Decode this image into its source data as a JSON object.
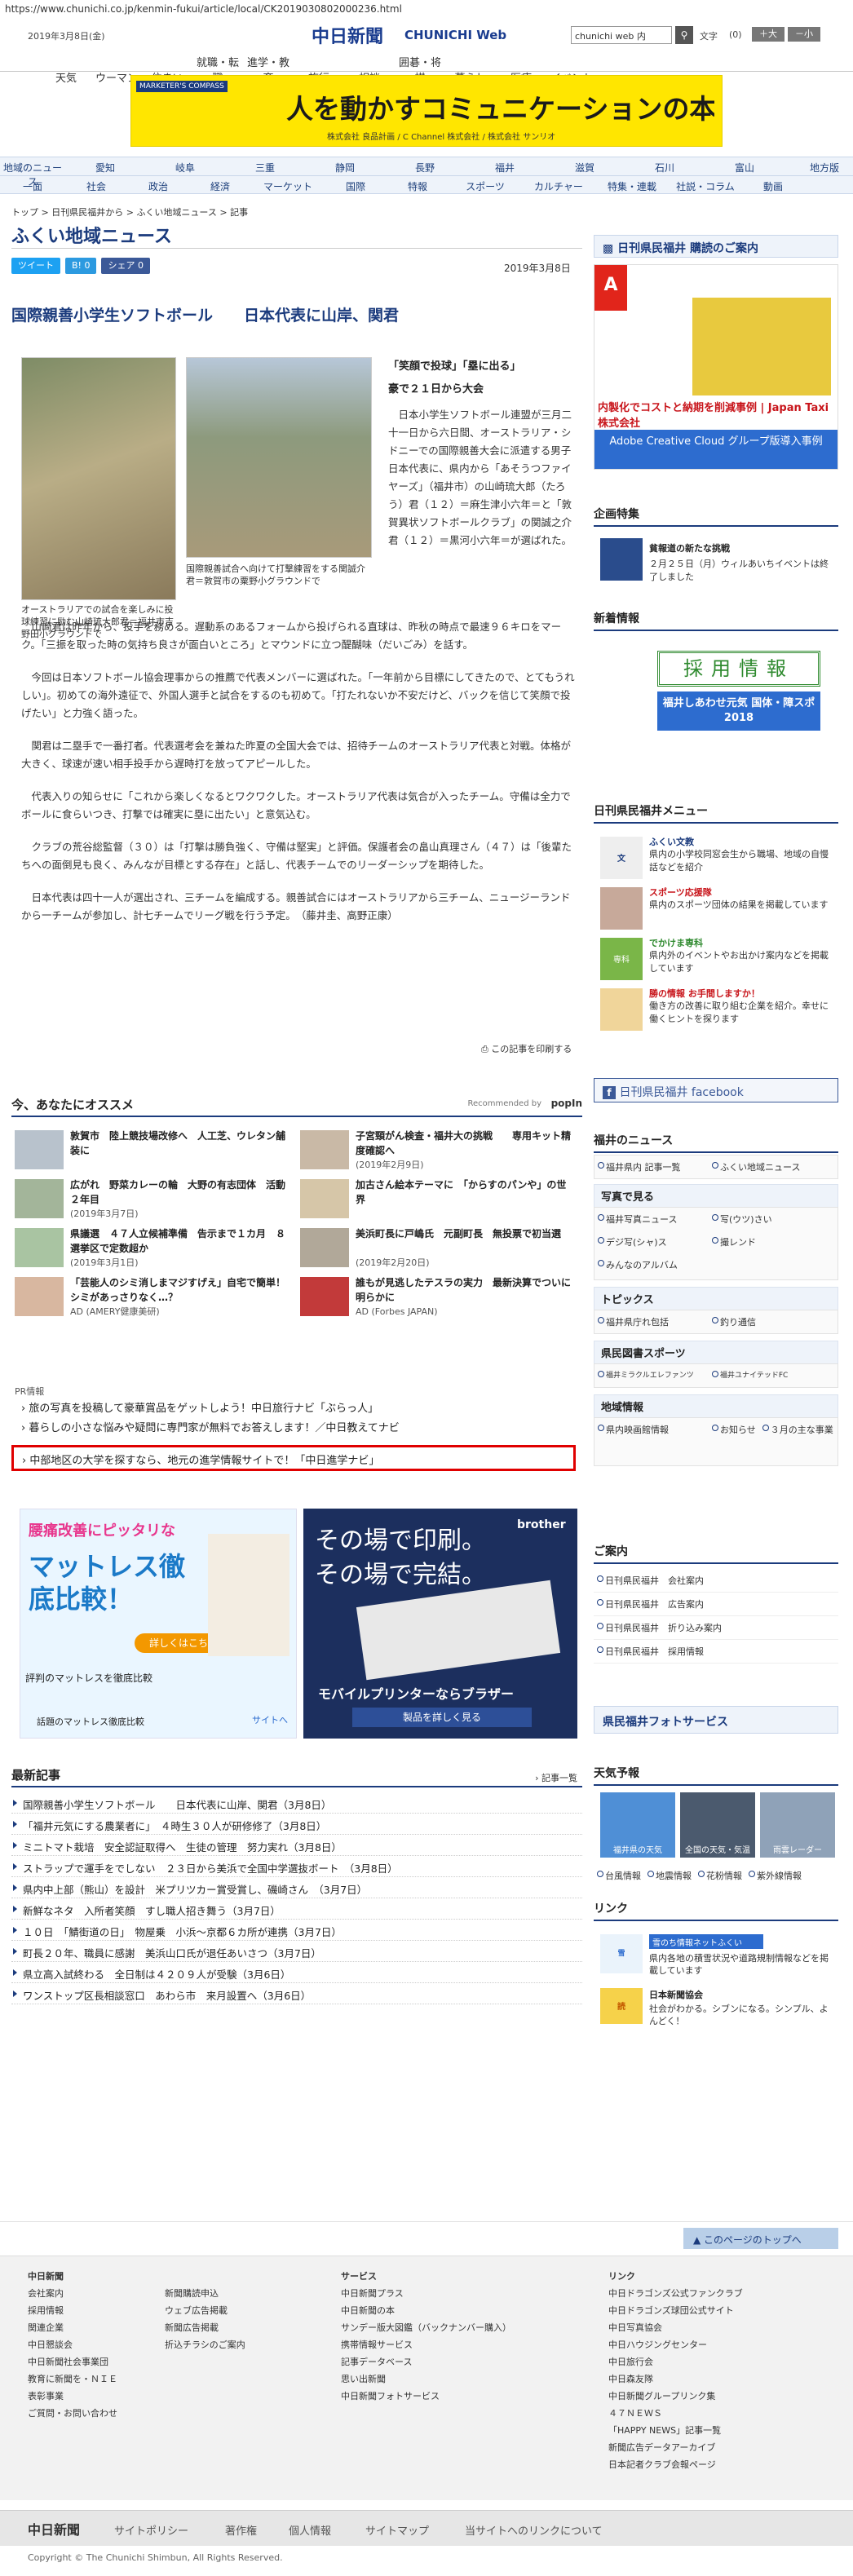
{
  "url": "https://www.chunichi.co.jp/kenmin-fukui/article/local/CK2019030802000236.html",
  "header": {
    "date": "2019年3月8日(金)",
    "logo": "中日新聞",
    "logo_en": "CHUNICHI Web",
    "search_value": "chunichi web 内",
    "char_label": "文字",
    "char_count": "(0)",
    "large": "＋大",
    "small": "－小"
  },
  "gnav": [
    "天気",
    "ウーマン",
    "住まい",
    "就職・転職",
    "進学・教育",
    "旅行",
    "相談",
    "囲碁・将棋",
    "暮らし",
    "医療",
    "イベント"
  ],
  "ad_top": {
    "headline": "人を動かすコミュニケーションの本質",
    "sub": "MARKETER'S COMPASS",
    "sponsor": "株式会社 良品計画 / C Channel 株式会社 / 株式会社 サンリオ"
  },
  "regional_nav": {
    "row1": [
      "地域のニュース",
      "愛知",
      "岐阜",
      "三重",
      "静岡",
      "長野",
      "福井",
      "滋賀",
      "石川",
      "富山",
      "地方版"
    ],
    "row2": [
      "一面",
      "社会",
      "政治",
      "経済",
      "マーケット",
      "国際",
      "特報",
      "スポーツ",
      "カルチャー",
      "特集・連載",
      "社説・コラム",
      "動画"
    ]
  },
  "breadcrumb": "トップ > 日刊県民福井から > ふくい地域ニュース > 記事",
  "section_title": "ふくい地域ニュース",
  "share": {
    "tweet": "ツイート",
    "hatena": "B! 0",
    "fb": "シェア 0"
  },
  "article": {
    "date": "2019年3月8日",
    "headline": "国際親善小学生ソフトボール　　日本代表に山岸、関君",
    "caption1": "オーストラリアでの試合を楽しみに投球練習に励む山崎琉大郎君＝福井市吉野田小グラウンドで",
    "caption2": "国際親善試合へ向けて打撃練習をする関誠介君＝敦賀市の粟野小グラウンドで",
    "sub1": "「笑顔で投球」「塁に出る」",
    "sub2": "豪で２１日から大会",
    "p_intro": "日本小学生ソフトボール連盟が三月二十一日から六日間、オーストラリア・シドニーでの国際親善大会に派遣する男子日本代表に、県内から「あそうつファイヤーズ」（福井市）の山崎琉大郎（たろう）君（１２）＝麻生津小六年＝と「敦賀異状ソフトボールクラブ」の関誠之介君（１２）＝黒河小六年＝が選ばれた。",
    "p1": "山崎君は昨年から、投手を務める。遅動系のあるフォームから投げられる直球は、昨秋の時点で最速９６キロをマーク。「三振を取った時の気持ち良さが面白いところ」とマウンドに立つ醍醐味（だいごみ）を話す。",
    "p2": "今回は日本ソフトボール協会理事からの推薦で代表メンバーに選ばれた。「一年前から目標にしてきたので、とてもうれしい」。初めての海外遠征で、外国人選手と試合をするのも初めて。「打たれないか不安だけど、バックを信じて笑顔で投げたい」と力強く語った。",
    "p3": "関君は二塁手で一番打者。代表選考会を兼ねた昨夏の全国大会では、招待チームのオーストラリア代表と対戦。体格が大きく、球速が速い相手投手から遅時打を放ってアピールした。",
    "p4": "代表入りの知らせに「これから楽しくなるとワクワクした。オーストラリア代表は気合が入ったチーム。守備は全力でボールに食らいつき、打撃では確実に塁に出たい」と意気込む。",
    "p5": "クラブの荒谷総監督（３０）は「打撃は勝負強く、守備は堅実」と評価。保護者会の畠山真理さん（４７）は「後輩たちへの面倒見も良く、みんなが目標とする存在」と話し、代表チームでのリーダーシップを期待した。",
    "p6": "日本代表は四十一人が選出され、三チームを編成する。親善試合にはオーストラリアから三チーム、ニュージーランドから一チームが参加し、計七チームでリーグ戦を行う予定。　（藤井圭、高野正康）",
    "print": "この記事を印刷する"
  },
  "recommend": {
    "title": "今、あなたにオススメ",
    "powered": "Recommended by",
    "brand": "popIn",
    "items": [
      {
        "t": "敦賀市　陸上競技場改修へ　人工芝、ウレタン舗装に",
        "d": ""
      },
      {
        "t": "子宮頸がん検査・福井大の挑戦　　専用キット精度確認へ",
        "d": "(2019年2月9日)"
      },
      {
        "t": "広がれ　野菜カレーの輪　大野の有志団体　活動２年目",
        "d": "(2019年3月7日)"
      },
      {
        "t": "加古さん絵本テーマに　「からすのパンや」の世界",
        "d": ""
      },
      {
        "t": "県議選　４７人立候補準備　告示まで１カ月　８選挙区で定数超か",
        "d": "(2019年3月1日)"
      },
      {
        "t": "美浜町長に戸嶋氏　元副町長　無投票で初当選",
        "d": "(2019年2月20日)"
      },
      {
        "t": "「芸能人のシミ消しまマジすげえ」自宅で簡単！シミがあっさりなく…？",
        "d": "AD (AMERY健康美研)"
      },
      {
        "t": "誰もが見逃したテスラの実力　最新決算でついに明らかに",
        "d": "AD (Forbes JAPAN)"
      }
    ]
  },
  "pr": {
    "label": "PR情報",
    "links": [
      "旅の写真を投稿して豪華賞品をゲットしよう！中日旅行ナビ「ぶらっ人」",
      "暮らしの小さな悩みや疑問に専門家が無料でお答えします！／中日教えてナビ",
      "中部地区の大学を探すなら、地元の進学情報サイトで！「中日進学ナビ」"
    ]
  },
  "ads_mid": {
    "left_title": "腰痛改善にピッタリな",
    "left_big": "マットレス徹底比較！",
    "left_btn": "詳しくはこちら",
    "left_caption": "評判のマットレスを徹底比較",
    "left_tag": "話題のマットレス徹底比較",
    "left_site": "サイトへ",
    "right_l1": "その場で印刷。",
    "right_l2": "その場で完結。",
    "right_brand": "brother",
    "right_bar": "モバイルプリンターならブラザー",
    "right_btn": "製品を詳しく見る"
  },
  "latest": {
    "title": "最新記事",
    "more": "記事一覧",
    "items": [
      "国際親善小学生ソフトボール　　日本代表に山岸、関君（3月8日）",
      "「福井元気にする農業者に」　４時生３０人が研修修了（3月8日）",
      "ミニトマト栽培　安全認証取得へ　生徒の管理　努力実れ（3月8日）",
      "ストラップで運手をでしない　２３日から美浜で全国中学選抜ボート　（3月8日）",
      "県内中上部（熊山）を設計　米プリツカー賞受賞し、磯崎さん　（3月7日）",
      "新鮮なネタ　入所者笑顔　すし職人招き舞う（3月7日）",
      "１０日　「鯖街道の日」　物屋乗　小浜～京都６カ所が連携（3月7日）",
      "町長２０年、職員に感謝　美浜山口氏が退任あいさつ（3月7日）",
      "県立高入試終わる　全日制は４２０９人が受験（3月6日）",
      "ワンストップ区長相談窓口　あわら市　来月設置へ（3月6日）"
    ]
  },
  "sidebar": {
    "paper_bar": "日刊県民福井 購読のご案内",
    "adobe_caption": "内製化でコストと納期を削減事例 | Japan Taxi 株式会社",
    "adobe_btn": "Adobe Creative Cloud グループ版導入事例",
    "kikaku_title": "企画特集",
    "kikaku_item": "貧報道の新たな挑戦",
    "kikaku_text": "２月２５日（月）ウィルあいちイベントは終了しました",
    "shinsa_title": "新着情報",
    "saiyo": "採用情報",
    "fukui_banner": "福井しあわせ元気 国体・障スポ2018",
    "menu_title": "日刊県民福井メニュー",
    "menu": [
      {
        "h": "ふくい文教",
        "t": "県内の小学校同窓会生から職場、地域の自慢話などを紹介"
      },
      {
        "h": "スポーツ応援隊",
        "t": "県内のスポーツ団体の結果を掲載しています"
      },
      {
        "h": "でかけま専科",
        "t": "県内外のイベントやお出かけ案内などを掲載しています"
      },
      {
        "h": "勝の情報 お手間しますか！",
        "t": "働き方の改善に取り組む企業を紹介。幸せに働くヒントを探ります"
      }
    ],
    "fb": "日刊県民福井 facebook",
    "news_title": "福井のニュース",
    "news_links": [
      "福井県内 記事一覧",
      "ふくい地域ニュース"
    ],
    "photo_title": "写真で見る",
    "photo_links": [
      "福井写真ニュース",
      "写(ウツ)さい",
      "デジ写(シャ)ス",
      "撮レンド",
      "みんなのアルバム"
    ],
    "topics_title": "トピックス",
    "topics_links": [
      "福井県庁れ包括",
      "釣り通信"
    ],
    "sports_title": "県民図書スポーツ",
    "sports_links": [
      "福井ミラクルエレファンツ",
      "福井ユナイテッドFC"
    ],
    "area_title": "地域情報",
    "area_links": [
      "県内映画館情報",
      "お知らせ",
      "３月の主な事業"
    ],
    "guide_title": "ご案内",
    "guide_links": [
      "日刊県民福井　会社案内",
      "日刊県民福井　広告案内",
      "日刊県民福井　折り込み案内",
      "日刊県民福井　採用情報"
    ],
    "photo_service": "県民福井フォトサービス",
    "weather_title": "天気予報",
    "weather_labels": [
      "福井県の天気",
      "全国の天気・気温",
      "雨雲レーダー"
    ],
    "weather_links": [
      "台風情報",
      "地震情報",
      "花粉情報",
      "紫外線情報"
    ],
    "link_title": "リンク",
    "link_items": [
      {
        "h": "雪のち情報ネットふくい",
        "t": "県内各地の積雪状況や道路規制情報などを掲載しています"
      },
      {
        "h": "日本新聞協会",
        "t": "社会がわかる。シブンになる。シンプル、よんどく！"
      }
    ]
  },
  "pagetop": "このページのトップへ",
  "footer": {
    "col1_title": "中日新聞",
    "col1": [
      "会社案内",
      "採用情報",
      "関連企業",
      "中日懇談会",
      "中日新聞社会事業団",
      "教育に新聞を・ＮＩＥ",
      "表彰事業",
      "ご質問・お問い合わせ"
    ],
    "col2": [
      "新聞購読申込",
      "ウェブ広告掲載",
      "新聞広告掲載",
      "折込チラシのご案内"
    ],
    "col3_title": "サービス",
    "col3": [
      "中日新聞プラス",
      "中日新聞の本",
      "サンデー版大図鑑（バックナンバー購入）",
      "携帯情報サービス",
      "記事データベース",
      "思い出新聞",
      "中日新聞フォトサービス"
    ],
    "col4_title": "リンク",
    "col4": [
      "中日ドラゴンズ公式ファンクラブ",
      "中日ドラゴンズ球団公式サイト",
      "中日写真協会",
      "中日ハウジングセンター",
      "中日旅行会",
      "中日森友隊",
      "中日新聞グループリンク集",
      "４７ＮＥＷＳ",
      "「HAPPY NEWS」記事一覧",
      "新聞広告データアーカイブ",
      "日本記者クラブ会報ページ"
    ],
    "bottom": [
      "中日新聞",
      "サイトポリシー",
      "著作権",
      "個人情報",
      "サイトマップ",
      "当サイトへのリンクについて"
    ],
    "copyright": "Copyright © The Chunichi Shimbun, All Rights Reserved."
  }
}
